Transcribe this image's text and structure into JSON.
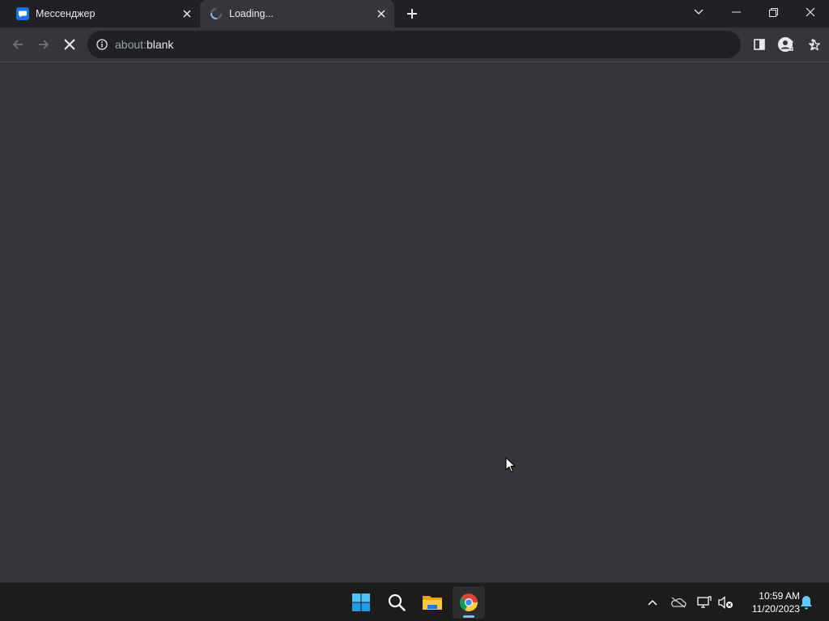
{
  "tabs": [
    {
      "title": "Мессенджер",
      "active": false,
      "favicon": "messenger-icon"
    },
    {
      "title": "Loading...",
      "active": true,
      "favicon": "loading-spinner-icon"
    }
  ],
  "toolbar": {
    "url_scheme": "about:",
    "url_host": "blank",
    "icons": [
      "back-arrow-icon",
      "forward-arrow-icon",
      "stop-icon",
      "info-icon",
      "share-icon",
      "star-icon",
      "side-panel-icon",
      "profile-icon",
      "menu-icon"
    ]
  },
  "taskbar": {
    "apps": [
      "windows-start-icon",
      "search-icon",
      "file-explorer-icon",
      "chrome-icon"
    ],
    "tray_icons": [
      "chevron-up-icon",
      "onedrive-icon",
      "network-icon",
      "volume-muted-icon",
      "notification-bell-icon"
    ],
    "time": "10:59 AM",
    "date": "11/20/2023"
  },
  "colors": {
    "tabstrip": "#202124",
    "toolbar": "#35363a",
    "content": "#35363a",
    "taskbar": "#1c1c1c",
    "accent": "#60cdff"
  }
}
